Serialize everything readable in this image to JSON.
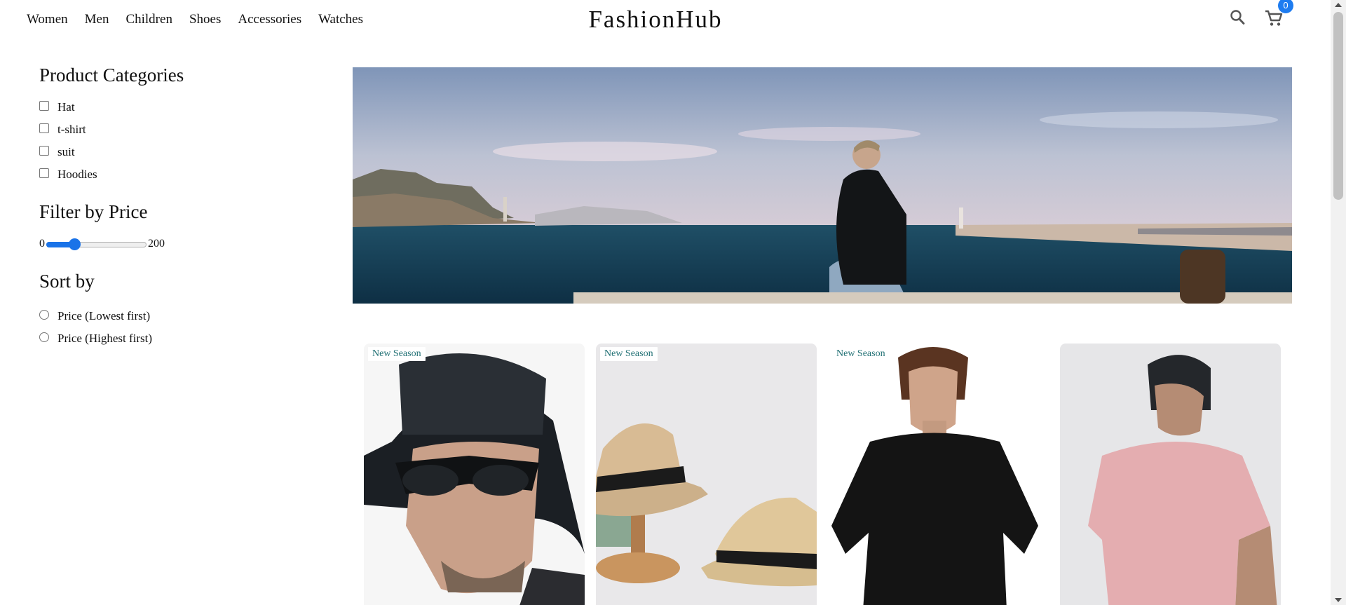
{
  "header": {
    "nav_items": [
      "Women",
      "Men",
      "Children",
      "Shoes",
      "Accessories",
      "Watches"
    ],
    "brand": "FashionHub",
    "search_icon": "search-icon",
    "cart_icon": "shopping-cart-icon",
    "cart_count": "0"
  },
  "sidebar": {
    "categories_title": "Product Categories",
    "categories": [
      "Hat",
      "t-shirt",
      "suit",
      "Hoodies"
    ],
    "price_title": "Filter by Price",
    "price_min": "0",
    "price_max": "200",
    "price_value_fraction": 0.28,
    "sort_title": "Sort by",
    "sort_options": [
      "Price (Lowest first)",
      "Price (Highest first)"
    ]
  },
  "products": [
    {
      "badge": "New Season",
      "image": "bucket-hat-sunglasses-man"
    },
    {
      "badge": "New Season",
      "image": "straw-fedora-hats"
    },
    {
      "badge": "New Season",
      "image": "black-oversized-tshirt-man"
    },
    {
      "badge": "",
      "image": "pink-tshirt-man-back"
    }
  ],
  "colors": {
    "accent": "#1e7cf0",
    "badge_text": "#1f6f73"
  }
}
